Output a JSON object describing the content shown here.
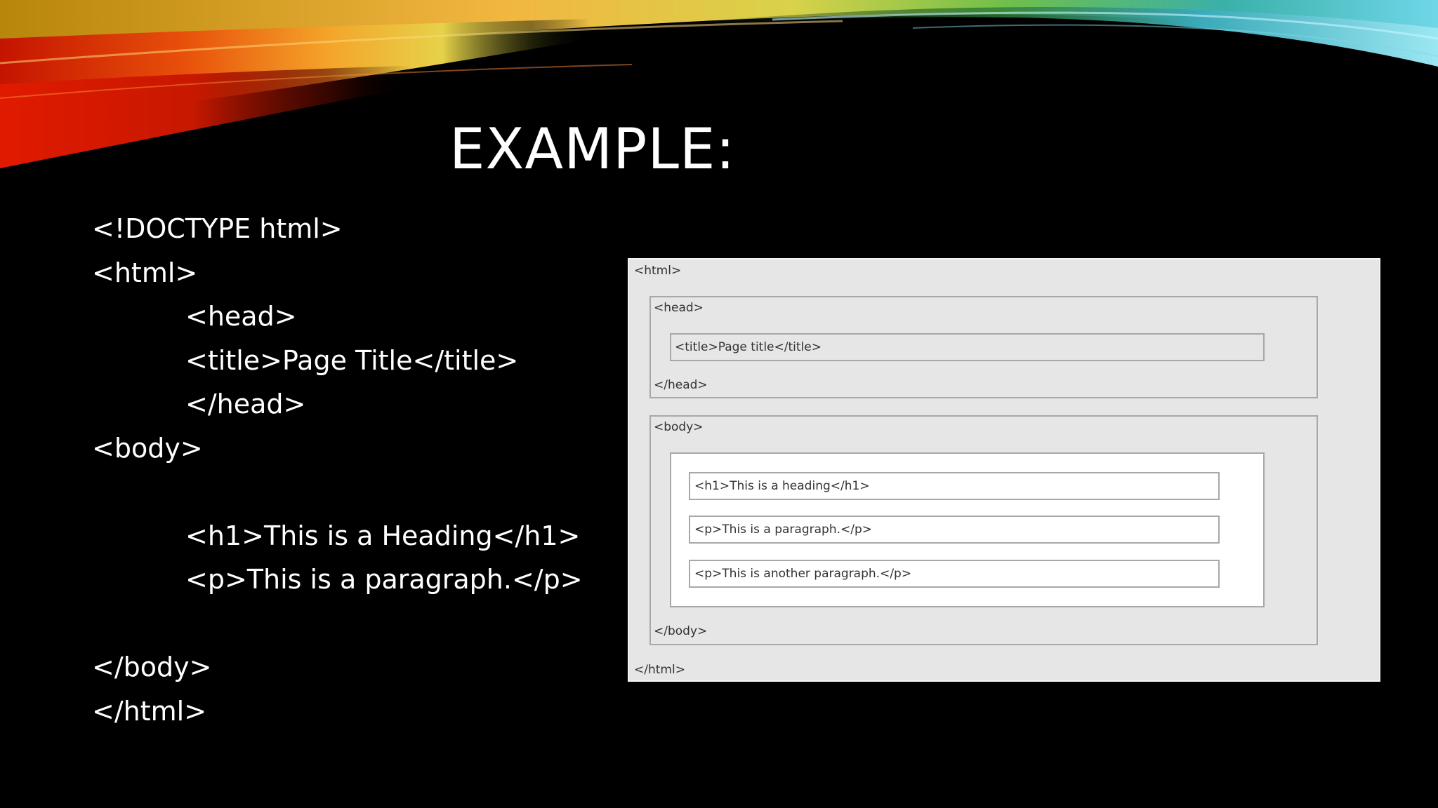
{
  "slide": {
    "title": "EXAMPLE:"
  },
  "code": {
    "lines": [
      "<!DOCTYPE html>",
      "<html>",
      "<head>",
      "<title>Page Title</title>",
      "</head>",
      "<body>",
      "<h1>This is a Heading</h1>",
      "<p>This is a paragraph.</p>",
      "</body>",
      "</html>"
    ]
  },
  "diagram": {
    "html_open": "<html>",
    "head_open": "<head>",
    "title_box": "<title>Page title</title>",
    "head_close": "</head>",
    "body_open": "<body>",
    "h1_box": "<h1>This is a heading</h1>",
    "p1_box": "<p>This is a paragraph.</p>",
    "p2_box": "<p>This is another paragraph.</p>",
    "body_close": "</body>",
    "html_close": "</html>"
  },
  "colors": {
    "background": "#000000",
    "text": "#ffffff",
    "diagram_bg": "#e6e6e6",
    "diagram_border": "#a8a8a8",
    "swoosh_red": "#d81e00",
    "swoosh_orange": "#f39c12",
    "swoosh_yellow": "#f4d03f",
    "swoosh_green": "#4caf50",
    "swoosh_cyan": "#5fd3e8"
  }
}
